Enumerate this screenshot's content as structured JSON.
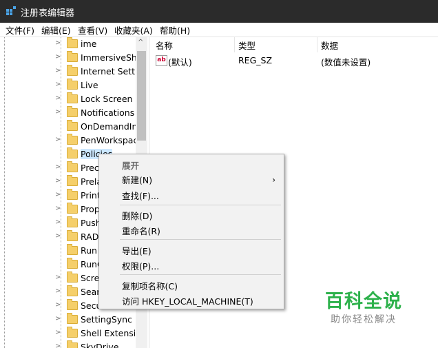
{
  "window": {
    "title": "注册表编辑器"
  },
  "menu": [
    "文件(F)",
    "编辑(E)",
    "查看(V)",
    "收藏夹(A)",
    "帮助(H)"
  ],
  "tree": {
    "items": [
      {
        "label": "ime",
        "expandable": true
      },
      {
        "label": "ImmersiveShe",
        "expandable": true
      },
      {
        "label": "Internet Settir",
        "expandable": true
      },
      {
        "label": "Live",
        "expandable": true
      },
      {
        "label": "Lock Screen",
        "expandable": true
      },
      {
        "label": "Notifications",
        "expandable": true
      },
      {
        "label": "OnDemandInt",
        "expandable": false
      },
      {
        "label": "PenWorkspac",
        "expandable": true
      },
      {
        "label": "Policies",
        "expandable": false,
        "selected": true
      },
      {
        "label": "Prec",
        "expandable": true
      },
      {
        "label": "Prela",
        "expandable": true
      },
      {
        "label": "Print",
        "expandable": true
      },
      {
        "label": "Prop",
        "expandable": true
      },
      {
        "label": "Push",
        "expandable": true
      },
      {
        "label": "RAD",
        "expandable": true
      },
      {
        "label": "Run",
        "expandable": false
      },
      {
        "label": "RunC",
        "expandable": false
      },
      {
        "label": "Scre",
        "expandable": true
      },
      {
        "label": "Sear",
        "expandable": true
      },
      {
        "label": "Secu",
        "expandable": true
      },
      {
        "label": "SettingSync",
        "expandable": true
      },
      {
        "label": "Shell Extensio",
        "expandable": true
      },
      {
        "label": "SkyDrive",
        "expandable": true
      }
    ]
  },
  "list": {
    "headers": [
      "名称",
      "类型",
      "数据"
    ],
    "rows": [
      {
        "name": "(默认)",
        "type": "REG_SZ",
        "data": "(数值未设置)"
      }
    ]
  },
  "context_menu": {
    "expand": "展开",
    "new": "新建(N)",
    "find": "查找(F)...",
    "delete": "删除(D)",
    "rename": "重命名(R)",
    "export": "导出(E)",
    "permissions": "权限(P)...",
    "copy_key_name": "复制项名称(C)",
    "visit": "访问 HKEY_LOCAL_MACHINE(T)"
  },
  "watermark": {
    "big": "百科全说",
    "small": "助你轻松解决"
  },
  "colors": {
    "titlebar": "#2b2b2b",
    "folder": "#f5cf6a",
    "selection": "#cce8ff",
    "watermark": "#2db14b"
  }
}
